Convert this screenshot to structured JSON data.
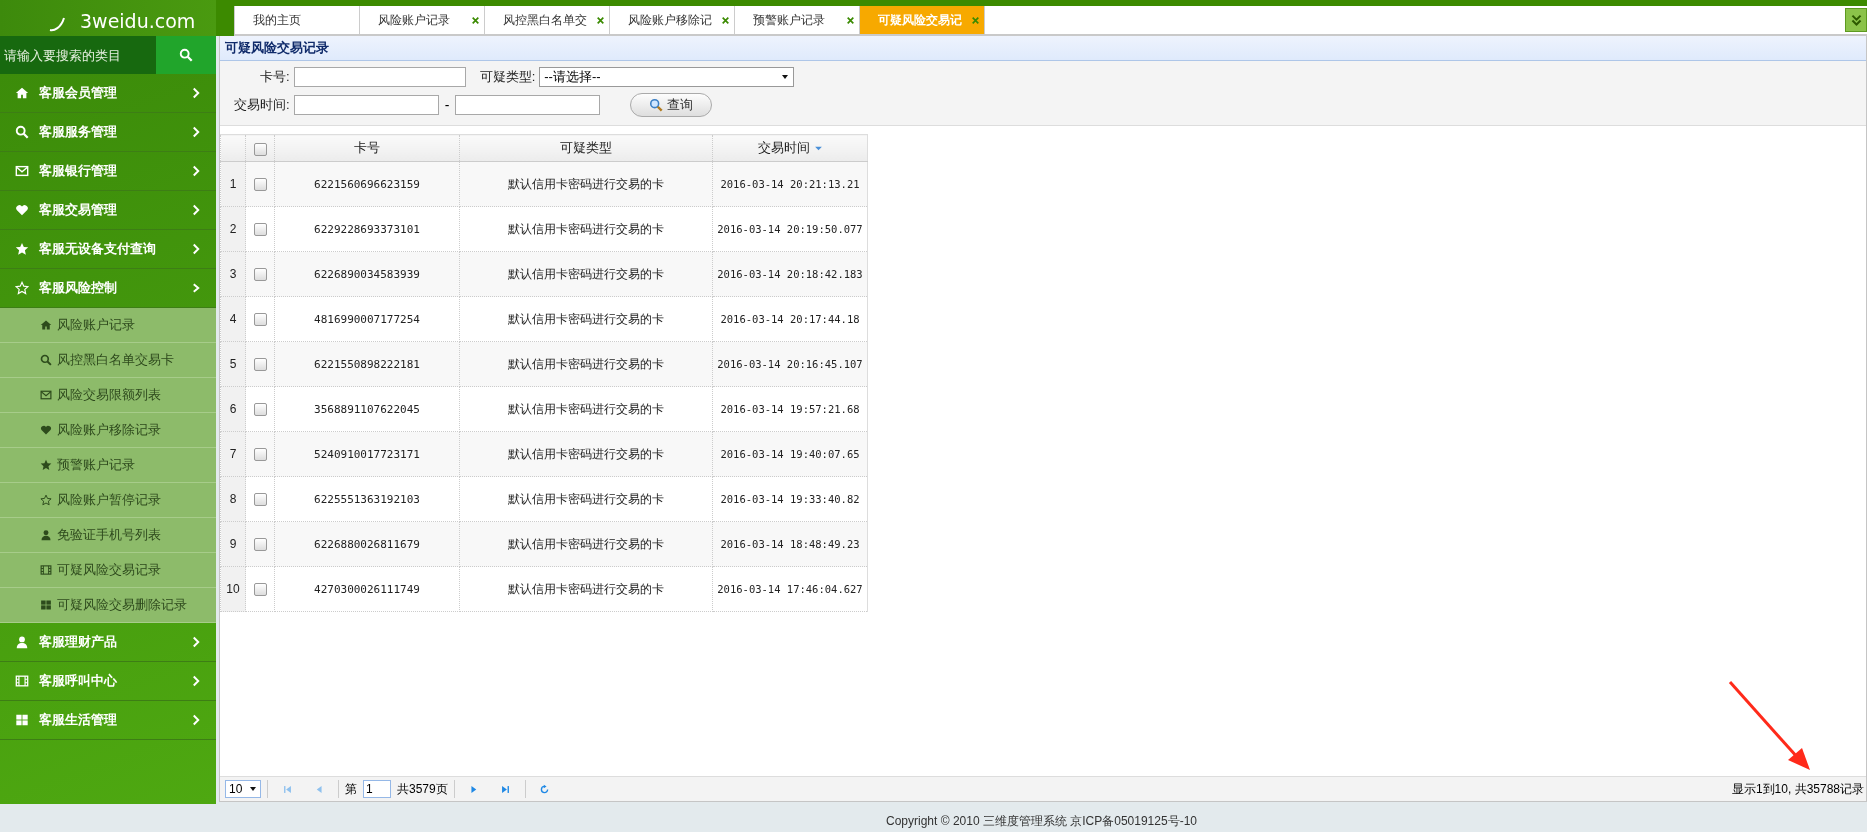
{
  "logo": {
    "text": "3weidu.com"
  },
  "sidebar": {
    "search": {
      "placeholder": "请输入要搜索的类目"
    },
    "items": [
      {
        "label": "客服会员管理",
        "expanded": false
      },
      {
        "label": "客服服务管理",
        "expanded": false
      },
      {
        "label": "客服银行管理",
        "expanded": false
      },
      {
        "label": "客服交易管理",
        "expanded": false
      },
      {
        "label": "客服无设备支付查询",
        "expanded": false
      },
      {
        "label": "客服风险控制",
        "expanded": true,
        "children": [
          {
            "label": "风险账户记录"
          },
          {
            "label": "风控黑白名单交易卡"
          },
          {
            "label": "风险交易限额列表"
          },
          {
            "label": "风险账户移除记录"
          },
          {
            "label": "预警账户记录"
          },
          {
            "label": "风险账户暂停记录"
          },
          {
            "label": "免验证手机号列表"
          },
          {
            "label": "可疑风险交易记录"
          },
          {
            "label": "可疑风险交易删除记录"
          }
        ]
      },
      {
        "label": "客服理财产品",
        "expanded": false
      },
      {
        "label": "客服呼叫中心",
        "expanded": false
      },
      {
        "label": "客服生活管理",
        "expanded": false
      }
    ]
  },
  "tabs": [
    {
      "label": "我的主页",
      "closable": false,
      "selected": false
    },
    {
      "label": "风险账户记录",
      "closable": true,
      "selected": false
    },
    {
      "label": "风控黑白名单交",
      "closable": true,
      "selected": false
    },
    {
      "label": "风险账户移除记",
      "closable": true,
      "selected": false
    },
    {
      "label": "预警账户记录",
      "closable": true,
      "selected": false
    },
    {
      "label": "可疑风险交易记",
      "closable": true,
      "selected": true
    }
  ],
  "panel": {
    "title": "可疑风险交易记录"
  },
  "filters": {
    "card_label": "卡号:",
    "type_label": "可疑类型:",
    "type_value": "--请选择--",
    "time_label": "交易时间:",
    "time_separator": "-",
    "search_button": "查询"
  },
  "table": {
    "select_all": {
      "checked": false
    },
    "columns": [
      {
        "label": "卡号",
        "sorted": false
      },
      {
        "label": "可疑类型",
        "sorted": false
      },
      {
        "label": "交易时间",
        "sorted": true
      }
    ],
    "rows": [
      {
        "index": "1",
        "checked": false,
        "card": "6221560696623159",
        "type": "默认信用卡密码进行交易的卡",
        "time": "2016-03-14 20:21:13.21"
      },
      {
        "index": "2",
        "checked": false,
        "card": "6229228693373101",
        "type": "默认信用卡密码进行交易的卡",
        "time": "2016-03-14 20:19:50.077"
      },
      {
        "index": "3",
        "checked": false,
        "card": "6226890034583939",
        "type": "默认信用卡密码进行交易的卡",
        "time": "2016-03-14 20:18:42.183"
      },
      {
        "index": "4",
        "checked": false,
        "card": "4816990007177254",
        "type": "默认信用卡密码进行交易的卡",
        "time": "2016-03-14 20:17:44.18"
      },
      {
        "index": "5",
        "checked": false,
        "card": "6221550898222181",
        "type": "默认信用卡密码进行交易的卡",
        "time": "2016-03-14 20:16:45.107"
      },
      {
        "index": "6",
        "checked": false,
        "card": "3568891107622045",
        "type": "默认信用卡密码进行交易的卡",
        "time": "2016-03-14 19:57:21.68"
      },
      {
        "index": "7",
        "checked": false,
        "card": "5240910017723171",
        "type": "默认信用卡密码进行交易的卡",
        "time": "2016-03-14 19:40:07.65"
      },
      {
        "index": "8",
        "checked": false,
        "card": "6225551363192103",
        "type": "默认信用卡密码进行交易的卡",
        "time": "2016-03-14 19:33:40.82"
      },
      {
        "index": "9",
        "checked": false,
        "card": "6226880026811679",
        "type": "默认信用卡密码进行交易的卡",
        "time": "2016-03-14 18:48:49.23"
      },
      {
        "index": "10",
        "checked": false,
        "card": "4270300026111749",
        "type": "默认信用卡密码进行交易的卡",
        "time": "2016-03-14 17:46:04.627"
      }
    ]
  },
  "pager": {
    "page_size": "10",
    "page_prefix": "第",
    "page": "1",
    "page_total": "共3579页",
    "summary": "显示1到10, 共35788记录"
  },
  "footer": {
    "text": "Copyright © 2010 三维度管理系统 京ICP备05019125号-10"
  }
}
